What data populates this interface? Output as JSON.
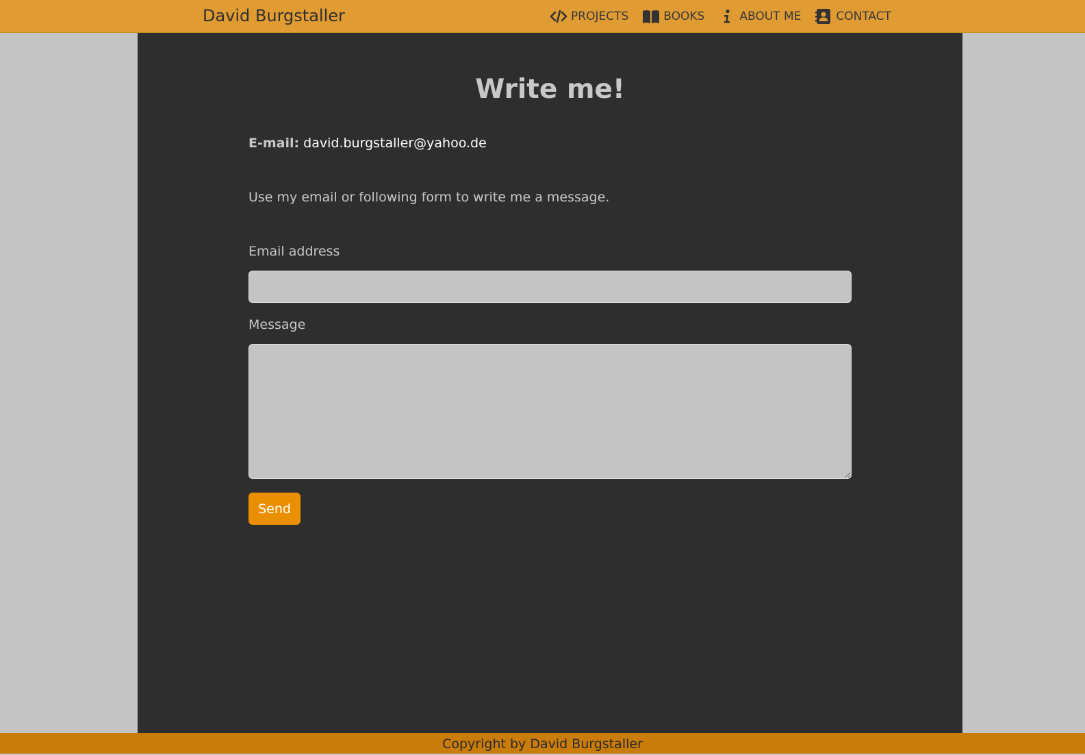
{
  "header": {
    "brand": "David Burgstaller",
    "nav": [
      {
        "label": "PROJECTS",
        "icon": "code-icon"
      },
      {
        "label": "BOOKS",
        "icon": "book-icon"
      },
      {
        "label": "ABOUT ME",
        "icon": "info-icon"
      },
      {
        "label": "CONTACT",
        "icon": "address-book-icon"
      }
    ]
  },
  "main": {
    "title": "Write me!",
    "email_label": "E-mail:",
    "email_value": "david.burgstaller@yahoo.de",
    "intro": "Use my email or following form to write me a message.",
    "form": {
      "email_label": "Email address",
      "email_value": "",
      "message_label": "Message",
      "message_value": "",
      "send_label": "Send"
    }
  },
  "footer": {
    "text": "Copyright by David Burgstaller"
  },
  "colors": {
    "navbar": "#e09b32",
    "content_bg": "#2e2e2e",
    "page_bg": "#c4c4c4",
    "button": "#ea8f00",
    "footer": "#c97c0a"
  }
}
